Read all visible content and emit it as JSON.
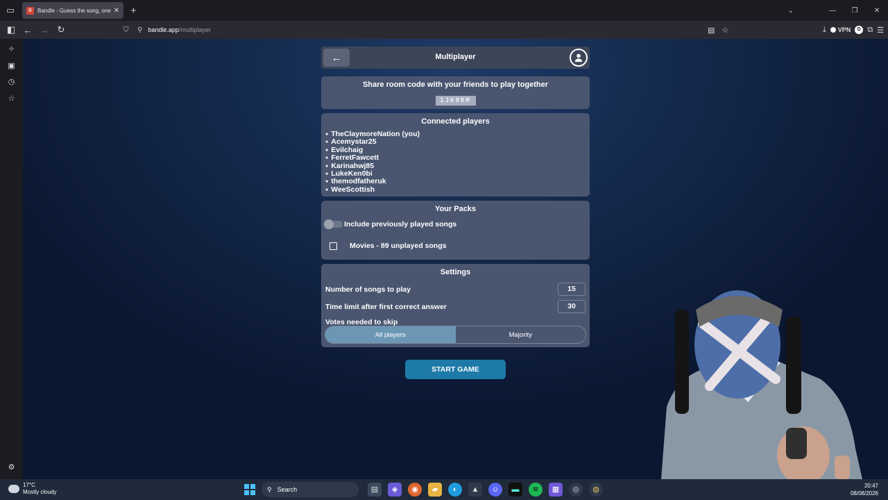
{
  "browser": {
    "tab_title": "Bandle - Guess the song, one in",
    "tab_favicon": "B",
    "url_host": "bandle.app",
    "url_path": "/multiplayer",
    "vpn_label": "VPN",
    "ext_letter": "D"
  },
  "app": {
    "title": "Multiplayer",
    "share_title": "Share room code with your friends to play together",
    "room_code": "1JK8RM",
    "players_title": "Connected players",
    "players": [
      "TheClaymoreNation (you)",
      "Acemystar25",
      "Evilchaig",
      "FerretFawcett",
      "Karinahwj85",
      "LukeKen0bi",
      "themodfatheruk",
      "WeeScottish"
    ],
    "packs_title": "Your Packs",
    "include_played_label": "Include previously played songs",
    "include_played_on": false,
    "pack_label": "Movies - 89 unplayed songs",
    "pack_checked": false,
    "settings_title": "Settings",
    "num_songs_label": "Number of songs to play",
    "num_songs_value": "15",
    "time_limit_label": "Time limit after first correct answer",
    "time_limit_value": "30",
    "votes_label": "Votes needed to skip",
    "votes_options": [
      "All players",
      "Majority"
    ],
    "votes_selected": "All players",
    "start_label": "START GAME"
  },
  "taskbar": {
    "temp": "17°C",
    "condition": "Mostly cloudy",
    "search_label": "Search",
    "time": "20:47",
    "date": "08/08/2026"
  },
  "colors": {
    "card": "#4a5670",
    "accent": "#1e7aa8",
    "segment_on": "#6b97b5"
  }
}
